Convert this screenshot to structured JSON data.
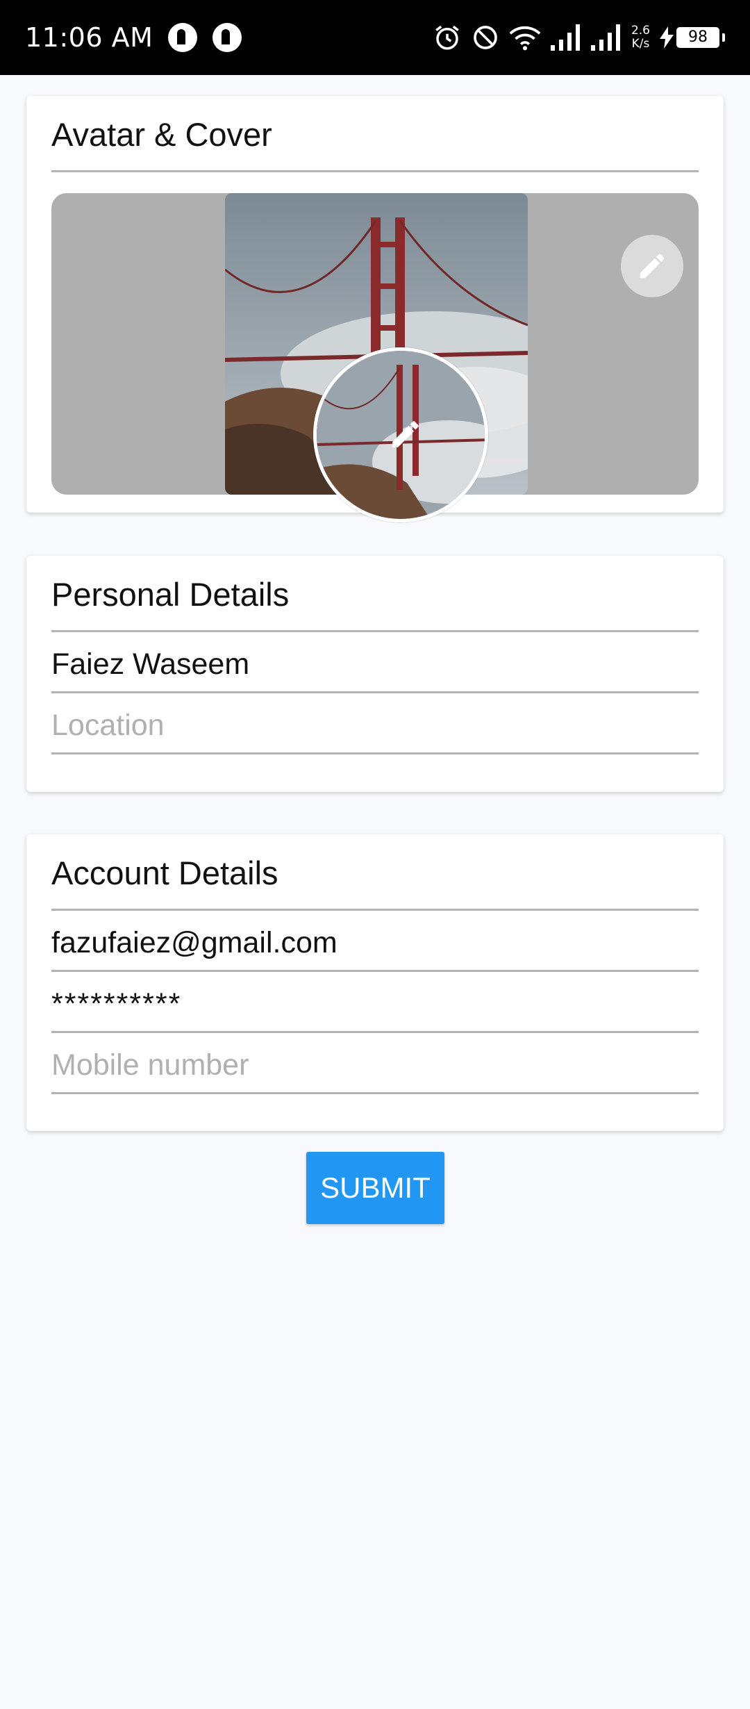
{
  "status_bar": {
    "time": "11:06 AM",
    "net_speed_top": "2.6",
    "net_speed_bottom": "K/s",
    "battery": "98",
    "icons": [
      "notification-icon",
      "notification-icon",
      "alarm-icon",
      "dnd-icon",
      "wifi-icon",
      "signal-icon",
      "signal-icon",
      "charging-icon",
      "battery-icon"
    ]
  },
  "avatar_cover": {
    "title": "Avatar & Cover",
    "cover_edit_icon": "pencil-icon",
    "avatar_edit_icon": "pencil-icon"
  },
  "personal": {
    "title": "Personal Details",
    "name_value": "Faiez Waseem",
    "location_placeholder": "Location"
  },
  "account": {
    "title": "Account Details",
    "email_value": "fazufaiez@gmail.com",
    "password_value": "**********",
    "mobile_placeholder": "Mobile number"
  },
  "submit_label": "SUBMIT",
  "colors": {
    "accent": "#2196f3",
    "status_bar": "#000000",
    "background": "#f8f9fd"
  }
}
